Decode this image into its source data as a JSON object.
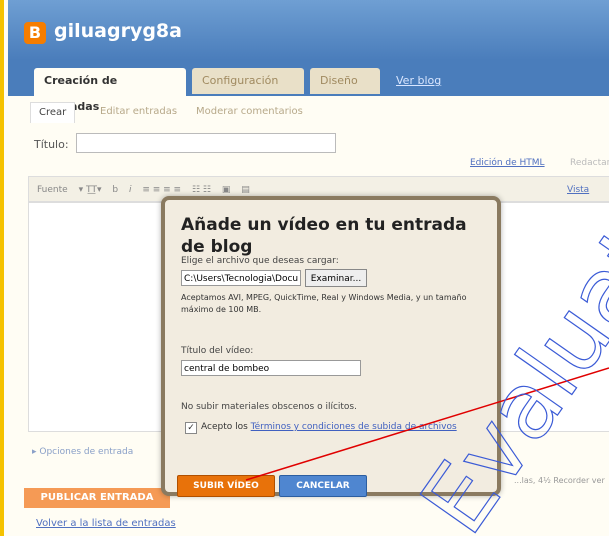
{
  "blog": {
    "name": "giluagryg8a"
  },
  "tabs": [
    {
      "label": "Creación de entradas"
    },
    {
      "label": "Configuración"
    },
    {
      "label": "Diseño"
    },
    {
      "label": "Ver blog"
    }
  ],
  "subtabs": [
    {
      "label": "Crear"
    },
    {
      "label": "Editar entradas"
    },
    {
      "label": "Moderar comentarios"
    }
  ],
  "editor": {
    "title_label": "Título:",
    "edit_html": "Edición de HTML",
    "compose": "Redactar",
    "preview": "Vista previa",
    "font_label": "Fuente",
    "entry_options": "▸ Opciones de entrada",
    "bottom_note": "...las, 4½ Recorder ver"
  },
  "publish_button": "PUBLICAR ENTRADA",
  "back_link": "Volver a la lista de entradas",
  "dialog": {
    "title": "Añade un vídeo en tu entrada de blog",
    "choose_file_label": "Elige el archivo que deseas cargar:",
    "file_value": "C:\\Users\\Tecnologia\\Docu",
    "browse_button": "Examinar...",
    "accepted_text": "Aceptamos AVI, MPEG, QuickTime, Real y Windows Media, y un tamaño máximo de 100 MB.",
    "video_title_label": "Título del vídeo:",
    "video_title_value": "central de bombeo",
    "no_upload_text": "No subir materiales obscenos o ilícitos.",
    "accept_prefix": "Acepto los",
    "terms_link": "Términos y condiciones de subida de archivos",
    "upload_button": "SUBIR VÍDEO",
    "cancel_button": "CANCELAR"
  },
  "watermark": {
    "text": "Evaluate"
  },
  "colors": {
    "accent_orange": "#e8720a",
    "blue": "#4f86d0",
    "header_blue": "#4a7dbb"
  }
}
